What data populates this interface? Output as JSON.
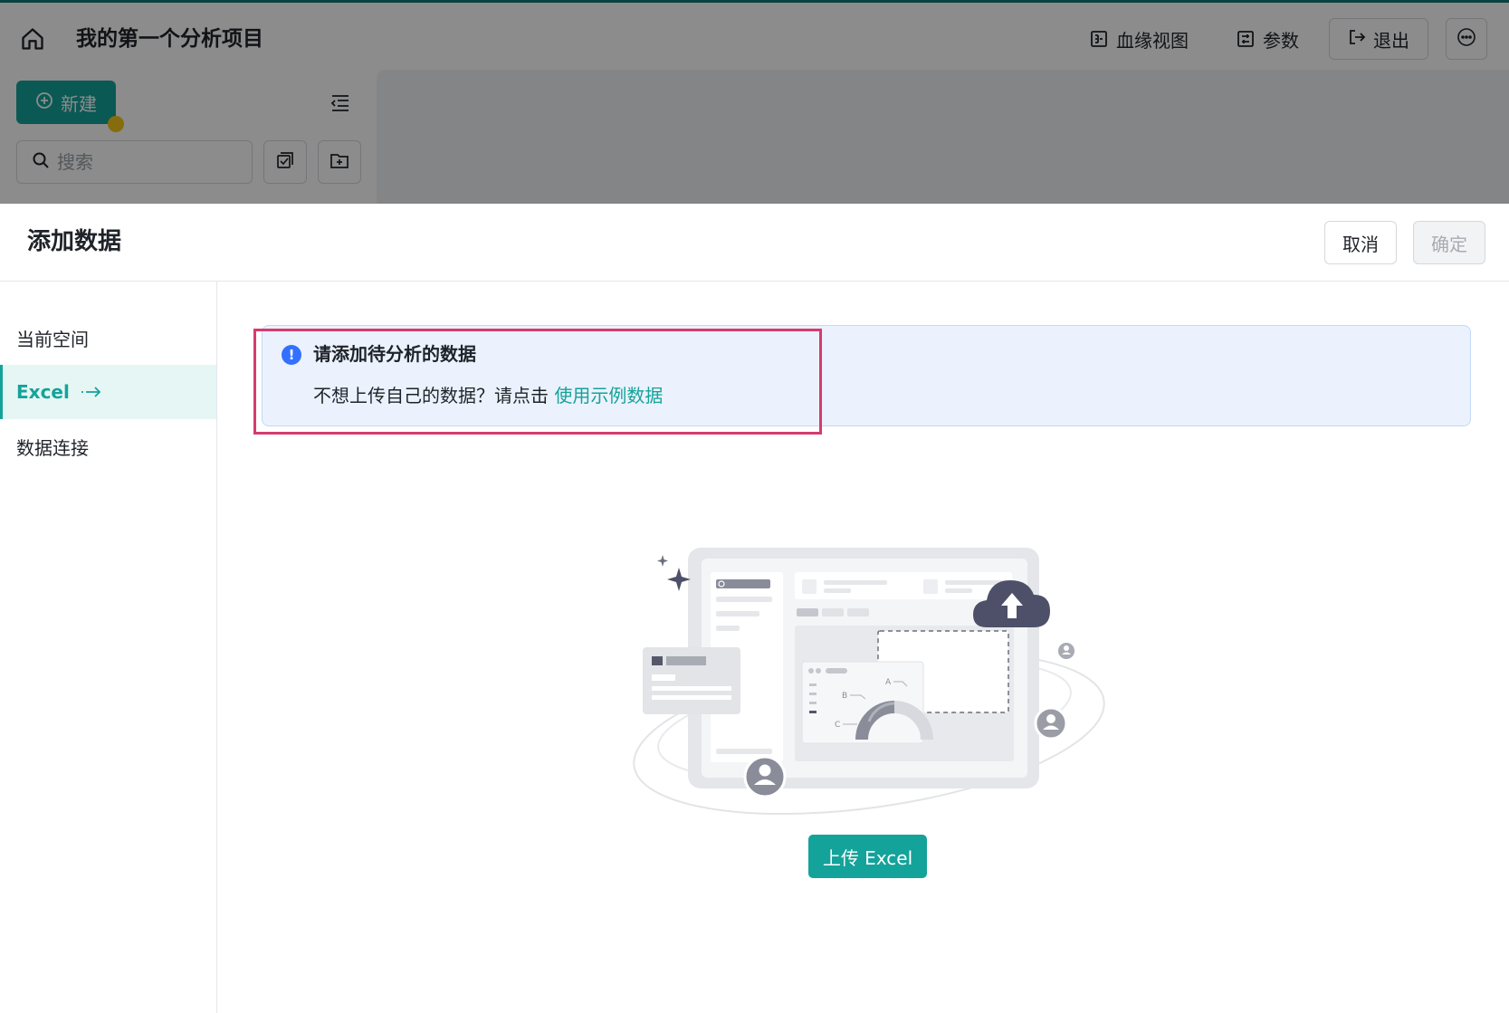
{
  "app": {
    "project_title": "我的第一个分析项目",
    "lineage_label": "血缘视图",
    "params_label": "参数",
    "exit_label": "退出",
    "new_label": "新建",
    "search_placeholder": "搜索"
  },
  "drawer": {
    "title": "添加数据",
    "cancel_label": "取消",
    "confirm_label": "确定",
    "nav": [
      {
        "label": "当前空间",
        "active": false
      },
      {
        "label": "Excel",
        "active": true
      },
      {
        "label": "数据连接",
        "active": false
      }
    ],
    "alert": {
      "title": "请添加待分析的数据",
      "desc": "不想上传自己的数据？请点击",
      "link": "使用示例数据"
    },
    "illustration": {
      "label_a": "A",
      "label_b": "B",
      "label_c": "C"
    },
    "upload_label": "上传 Excel"
  },
  "colors": {
    "accent": "#14a39a",
    "info": "#3370ff",
    "highlight": "#d63b6e"
  }
}
